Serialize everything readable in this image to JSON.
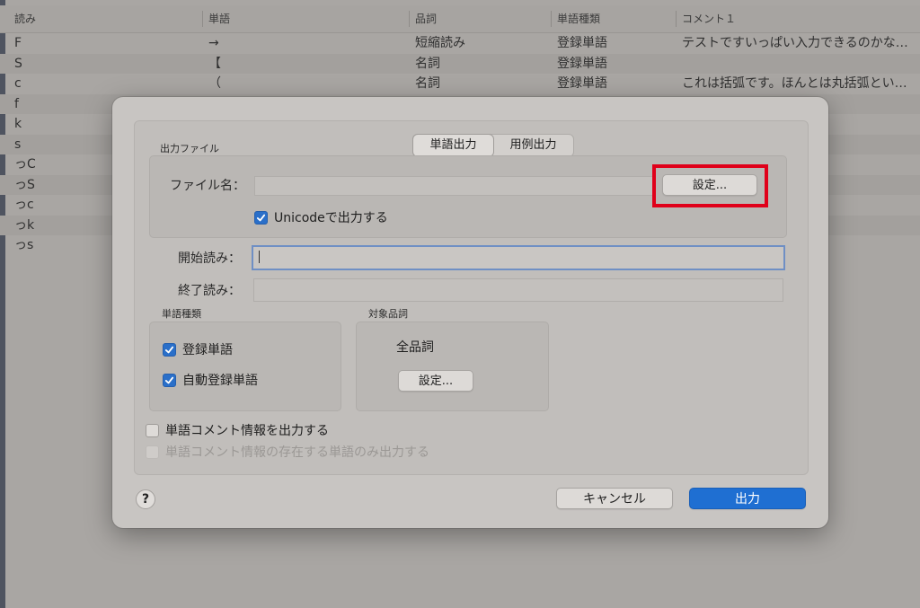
{
  "background_table": {
    "columns": [
      "読み",
      "単語",
      "品詞",
      "単語種類",
      "コメント１"
    ],
    "rows": [
      [
        "F",
        "→",
        "短縮読み",
        "登録単語",
        "テストですいっぱい入力できるのかな…"
      ],
      [
        "S",
        "【",
        "名詞",
        "登録単語",
        ""
      ],
      [
        "c",
        "（",
        "名詞",
        "登録単語",
        "これは括弧です。ほんとは丸括弧とい…"
      ],
      [
        "f",
        "",
        "",
        "",
        ""
      ],
      [
        "k",
        "",
        "",
        "",
        ""
      ],
      [
        "s",
        "",
        "",
        "",
        ""
      ],
      [
        "っC",
        "",
        "",
        "",
        ""
      ],
      [
        "っS",
        "",
        "",
        "",
        ""
      ],
      [
        "っc",
        "",
        "",
        "",
        ""
      ],
      [
        "っk",
        "",
        "",
        "",
        ""
      ],
      [
        "っs",
        "",
        "",
        "",
        ""
      ]
    ]
  },
  "dialog": {
    "tabs": [
      {
        "label": "単語出力",
        "active": true
      },
      {
        "label": "用例出力",
        "active": false
      }
    ],
    "output_file": {
      "group_label": "出力ファイル",
      "filename_label": "ファイル名：",
      "filename_value": "",
      "set_button": "設定...",
      "unicode_label": "Unicodeで出力する",
      "unicode_checked": true
    },
    "start_reading": {
      "label": "開始読み：",
      "value": ""
    },
    "end_reading": {
      "label": "終了読み：",
      "value": ""
    },
    "word_type": {
      "group_label": "単語種類",
      "registered_label": "登録単語",
      "registered_checked": true,
      "auto_label": "自動登録単語",
      "auto_checked": true
    },
    "target_pos": {
      "group_label": "対象品詞",
      "value": "全品詞",
      "set_button": "設定..."
    },
    "comment_output": {
      "label": "単語コメント情報を出力する",
      "checked": false
    },
    "comment_only": {
      "label": "単語コメント情報の存在する単語のみ出力する",
      "checked": false,
      "disabled": true
    },
    "help_label": "?",
    "cancel_button": "キャンセル",
    "ok_button": "出力"
  },
  "colors": {
    "accent": "#1f6fd2",
    "highlight": "#e0001a"
  }
}
